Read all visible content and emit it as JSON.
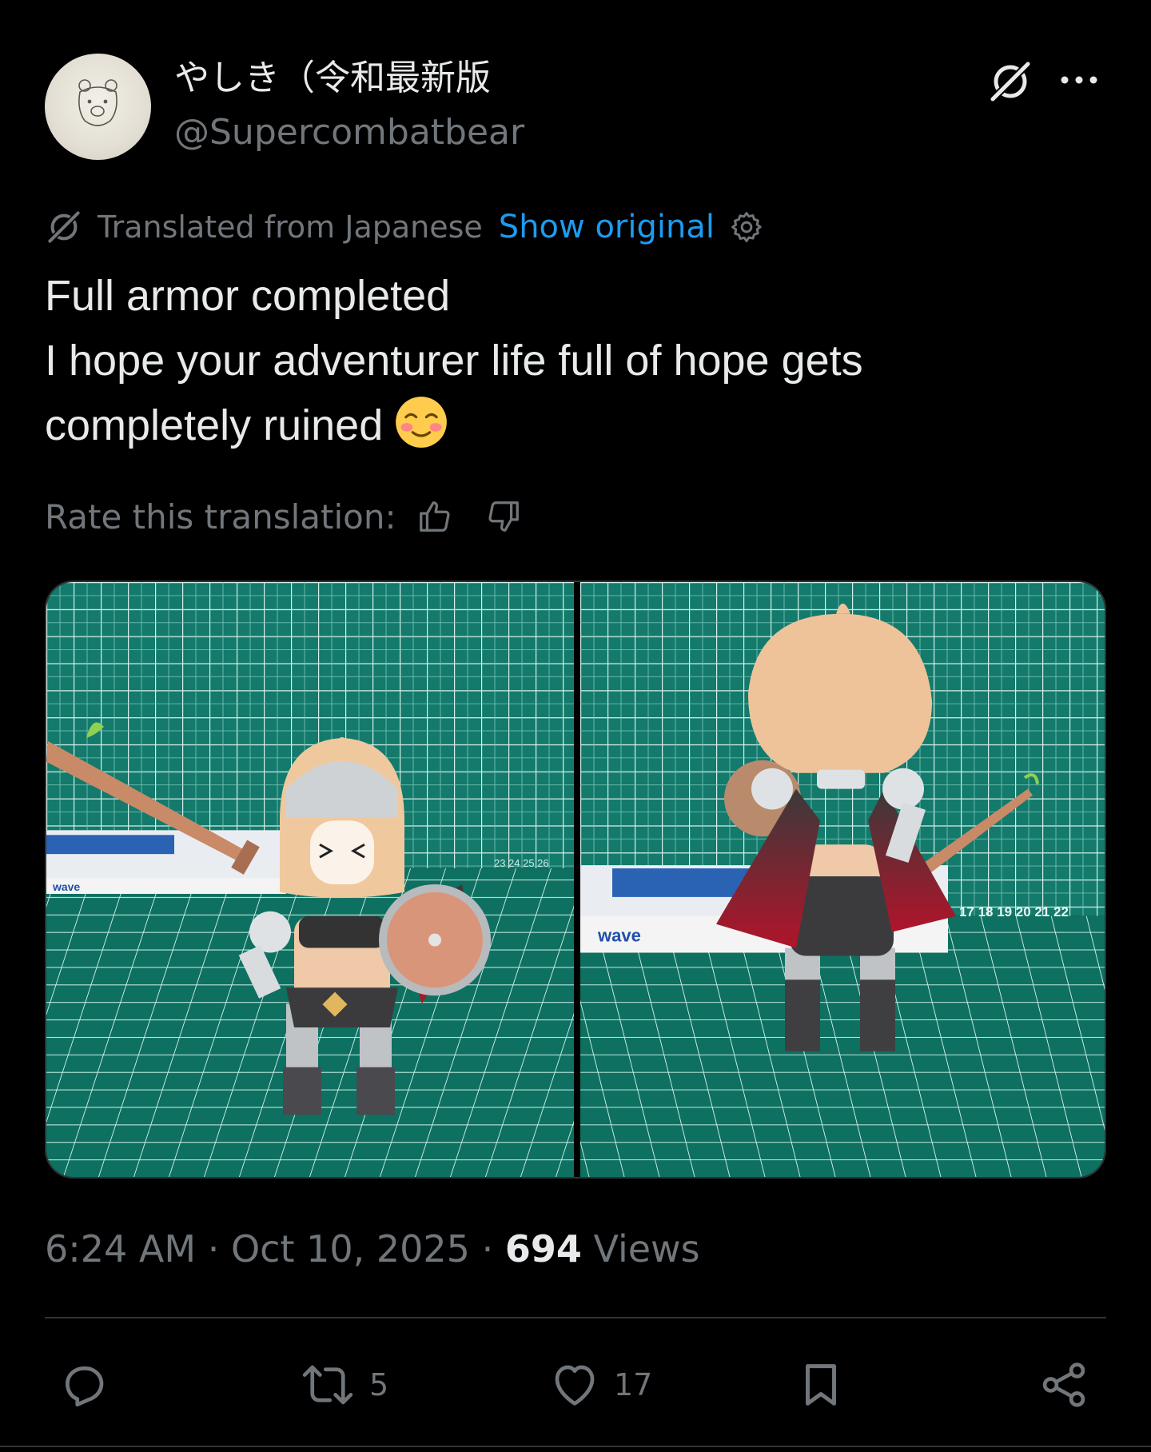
{
  "author": {
    "display_name": "やしき（令和最新版",
    "handle": "@Supercombatbear"
  },
  "translation": {
    "label": "Translated from Japanese",
    "show_original": "Show original"
  },
  "tweet": {
    "lines": [
      "Full armor completed",
      "I hope your adventurer life full of hope gets",
      "completely ruined"
    ],
    "emoji": "smiling-face-with-blush"
  },
  "rate": {
    "label": "Rate this translation:"
  },
  "media": {
    "left_photo_ruler": "23 24 25 26",
    "right_photo_ruler": "17 18 19 20 21 22",
    "box_brand": "wave"
  },
  "meta": {
    "time": "6:24 AM",
    "separator": "·",
    "date": "Oct 10, 2025",
    "views_count": "694",
    "views_label": "Views"
  },
  "actions": {
    "reply_count": "",
    "repost_count": "5",
    "like_count": "17"
  },
  "colors": {
    "background": "#000000",
    "text": "#e7e9ea",
    "muted": "#71767b",
    "accent": "#1d9bf0",
    "divider": "#2f3336",
    "cutting_mat": "#137a6c"
  },
  "icons": {
    "grok": "grok-icon",
    "more": "more-icon",
    "gear": "gear-icon",
    "thumbs_up": "thumbs-up-icon",
    "thumbs_down": "thumbs-down-icon",
    "reply": "reply-icon",
    "repost": "repost-icon",
    "like": "heart-icon",
    "bookmark": "bookmark-icon",
    "share": "share-icon"
  }
}
